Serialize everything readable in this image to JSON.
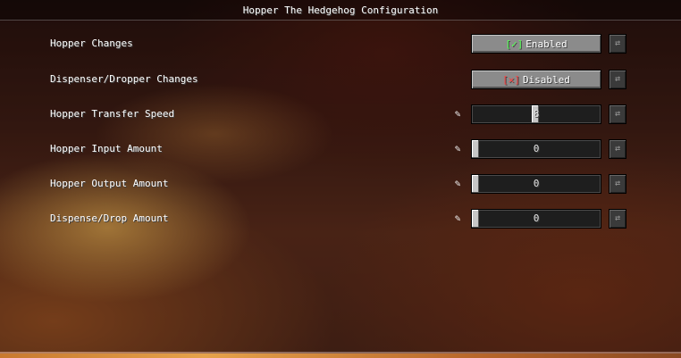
{
  "header": {
    "title": "Hopper The Hedgehog Configuration"
  },
  "options": [
    {
      "label": "Hopper Changes",
      "type": "toggle",
      "state": "on",
      "value_text": "Enabled",
      "check_glyph": "✓"
    },
    {
      "label": "Dispenser/Dropper Changes",
      "type": "toggle",
      "state": "off",
      "value_text": "Disabled",
      "check_glyph": "✕"
    },
    {
      "label": "Hopper Transfer Speed",
      "type": "slider",
      "value_text": "8",
      "fraction": 0.49
    },
    {
      "label": "Hopper Input Amount",
      "type": "slider",
      "value_text": "0",
      "fraction": 0.0
    },
    {
      "label": "Hopper Output Amount",
      "type": "slider",
      "value_text": "0",
      "fraction": 0.0
    },
    {
      "label": "Dispense/Drop Amount",
      "type": "slider",
      "value_text": "0",
      "fraction": 0.0
    }
  ],
  "icons": {
    "edit": "pencil-icon",
    "reset": "reset-icon"
  },
  "colors": {
    "enabled": "#55ff55",
    "disabled": "#ff4444",
    "button": "#8b8b8b"
  }
}
